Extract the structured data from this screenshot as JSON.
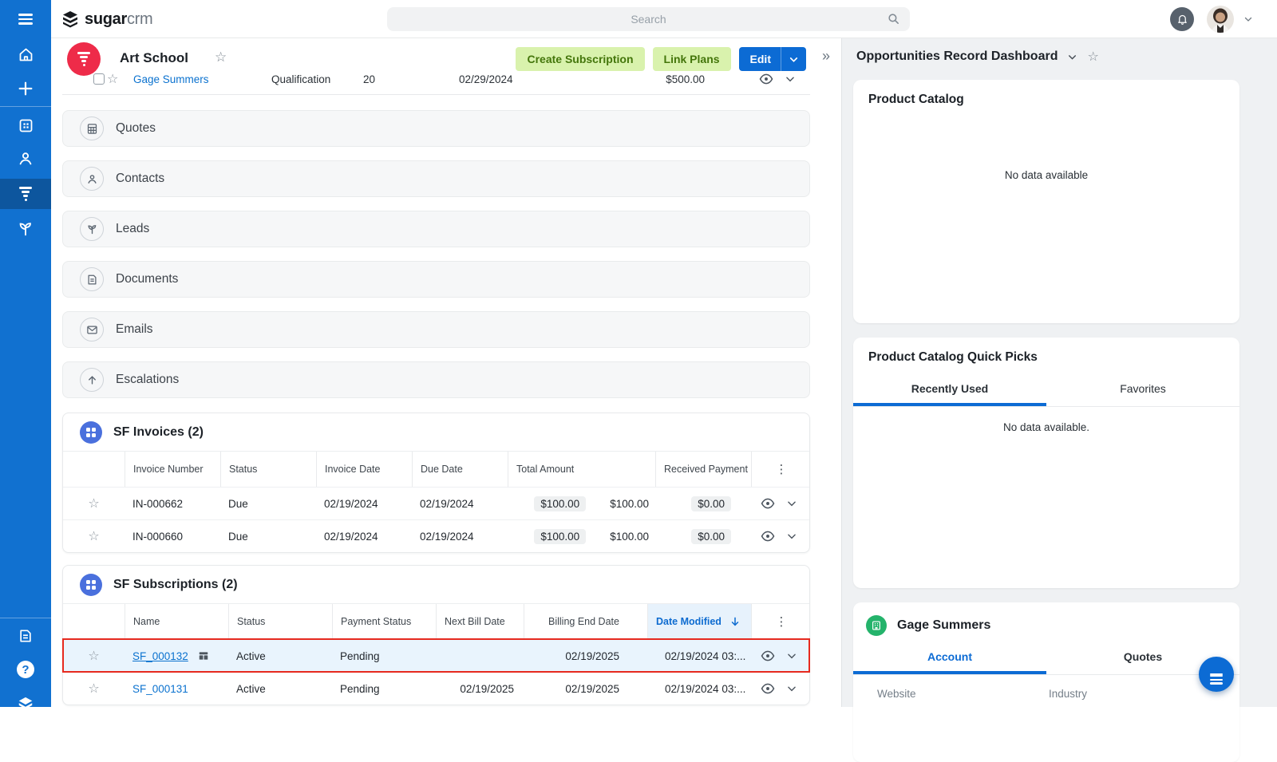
{
  "colors": {
    "sidebar_blue": "#1171d0",
    "sidebar_active_blue": "#0d569e",
    "accent_blue": "#0c6bd4",
    "filter_red": "#ee2b49",
    "highlight_red": "#e62a1f",
    "highlight_row_bg": "#e9f4fd",
    "button_green_bg": "#d9f2ad",
    "button_green_text": "#44760b",
    "link_blue": "#0b72cf",
    "sorted_header_bg": "#e7f2fc",
    "panel_gray": "#f6f7f8",
    "dashboard_bg": "#eff1f3",
    "green_icon": "#24b36b",
    "app_icon_blue": "#4a70dd"
  },
  "topbar": {
    "logo_bold": "sugar",
    "logo_light": "crm",
    "search_placeholder": "Search"
  },
  "record": {
    "title": "Art School",
    "actions": {
      "create_subscription": "Create Subscription",
      "link_plans": "Link Plans",
      "edit": "Edit"
    }
  },
  "cutoff_row": {
    "name": "Gage Summers",
    "stage": "Qualification",
    "probability": "20",
    "date": "02/29/2024",
    "amount": "$500.00"
  },
  "panels": [
    {
      "label": "Quotes"
    },
    {
      "label": "Contacts"
    },
    {
      "label": "Leads"
    },
    {
      "label": "Documents"
    },
    {
      "label": "Emails"
    },
    {
      "label": "Escalations"
    }
  ],
  "invoices": {
    "title": "SF Invoices (2)",
    "columns": {
      "number": "Invoice Number",
      "status": "Status",
      "invoice_date": "Invoice Date",
      "due_date": "Due Date",
      "total": "Total Amount",
      "received": "Received Payment"
    },
    "rows": [
      {
        "number": "IN-000662",
        "status": "Due",
        "invoice_date": "02/19/2024",
        "due_date": "02/19/2024",
        "total_badge": "$100.00",
        "total_plain": "$100.00",
        "received": "$0.00"
      },
      {
        "number": "IN-000660",
        "status": "Due",
        "invoice_date": "02/19/2024",
        "due_date": "02/19/2024",
        "total_badge": "$100.00",
        "total_plain": "$100.00",
        "received": "$0.00"
      }
    ]
  },
  "subscriptions": {
    "title": "SF Subscriptions (2)",
    "columns": {
      "name": "Name",
      "status": "Status",
      "payment_status": "Payment Status",
      "next_bill": "Next Bill Date",
      "billing_end": "Billing End Date",
      "modified": "Date Modified"
    },
    "rows": [
      {
        "name": "SF_000132",
        "status": "Active",
        "payment_status": "Pending",
        "next_bill": "",
        "billing_end": "02/19/2025",
        "modified": "02/19/2024 03:..."
      },
      {
        "name": "SF_000131",
        "status": "Active",
        "payment_status": "Pending",
        "next_bill": "02/19/2025",
        "billing_end": "02/19/2025",
        "modified": "02/19/2024 03:..."
      }
    ]
  },
  "dashboard": {
    "title": "Opportunities Record Dashboard",
    "product_catalog": {
      "title": "Product Catalog",
      "empty": "No data available"
    },
    "quick_picks": {
      "title": "Product Catalog Quick Picks",
      "tab_recent": "Recently Used",
      "tab_favorites": "Favorites",
      "empty": "No data available."
    },
    "record_card": {
      "title": "Gage Summers",
      "tab_account": "Account",
      "tab_quotes": "Quotes",
      "field_website": "Website",
      "field_industry": "Industry"
    }
  }
}
